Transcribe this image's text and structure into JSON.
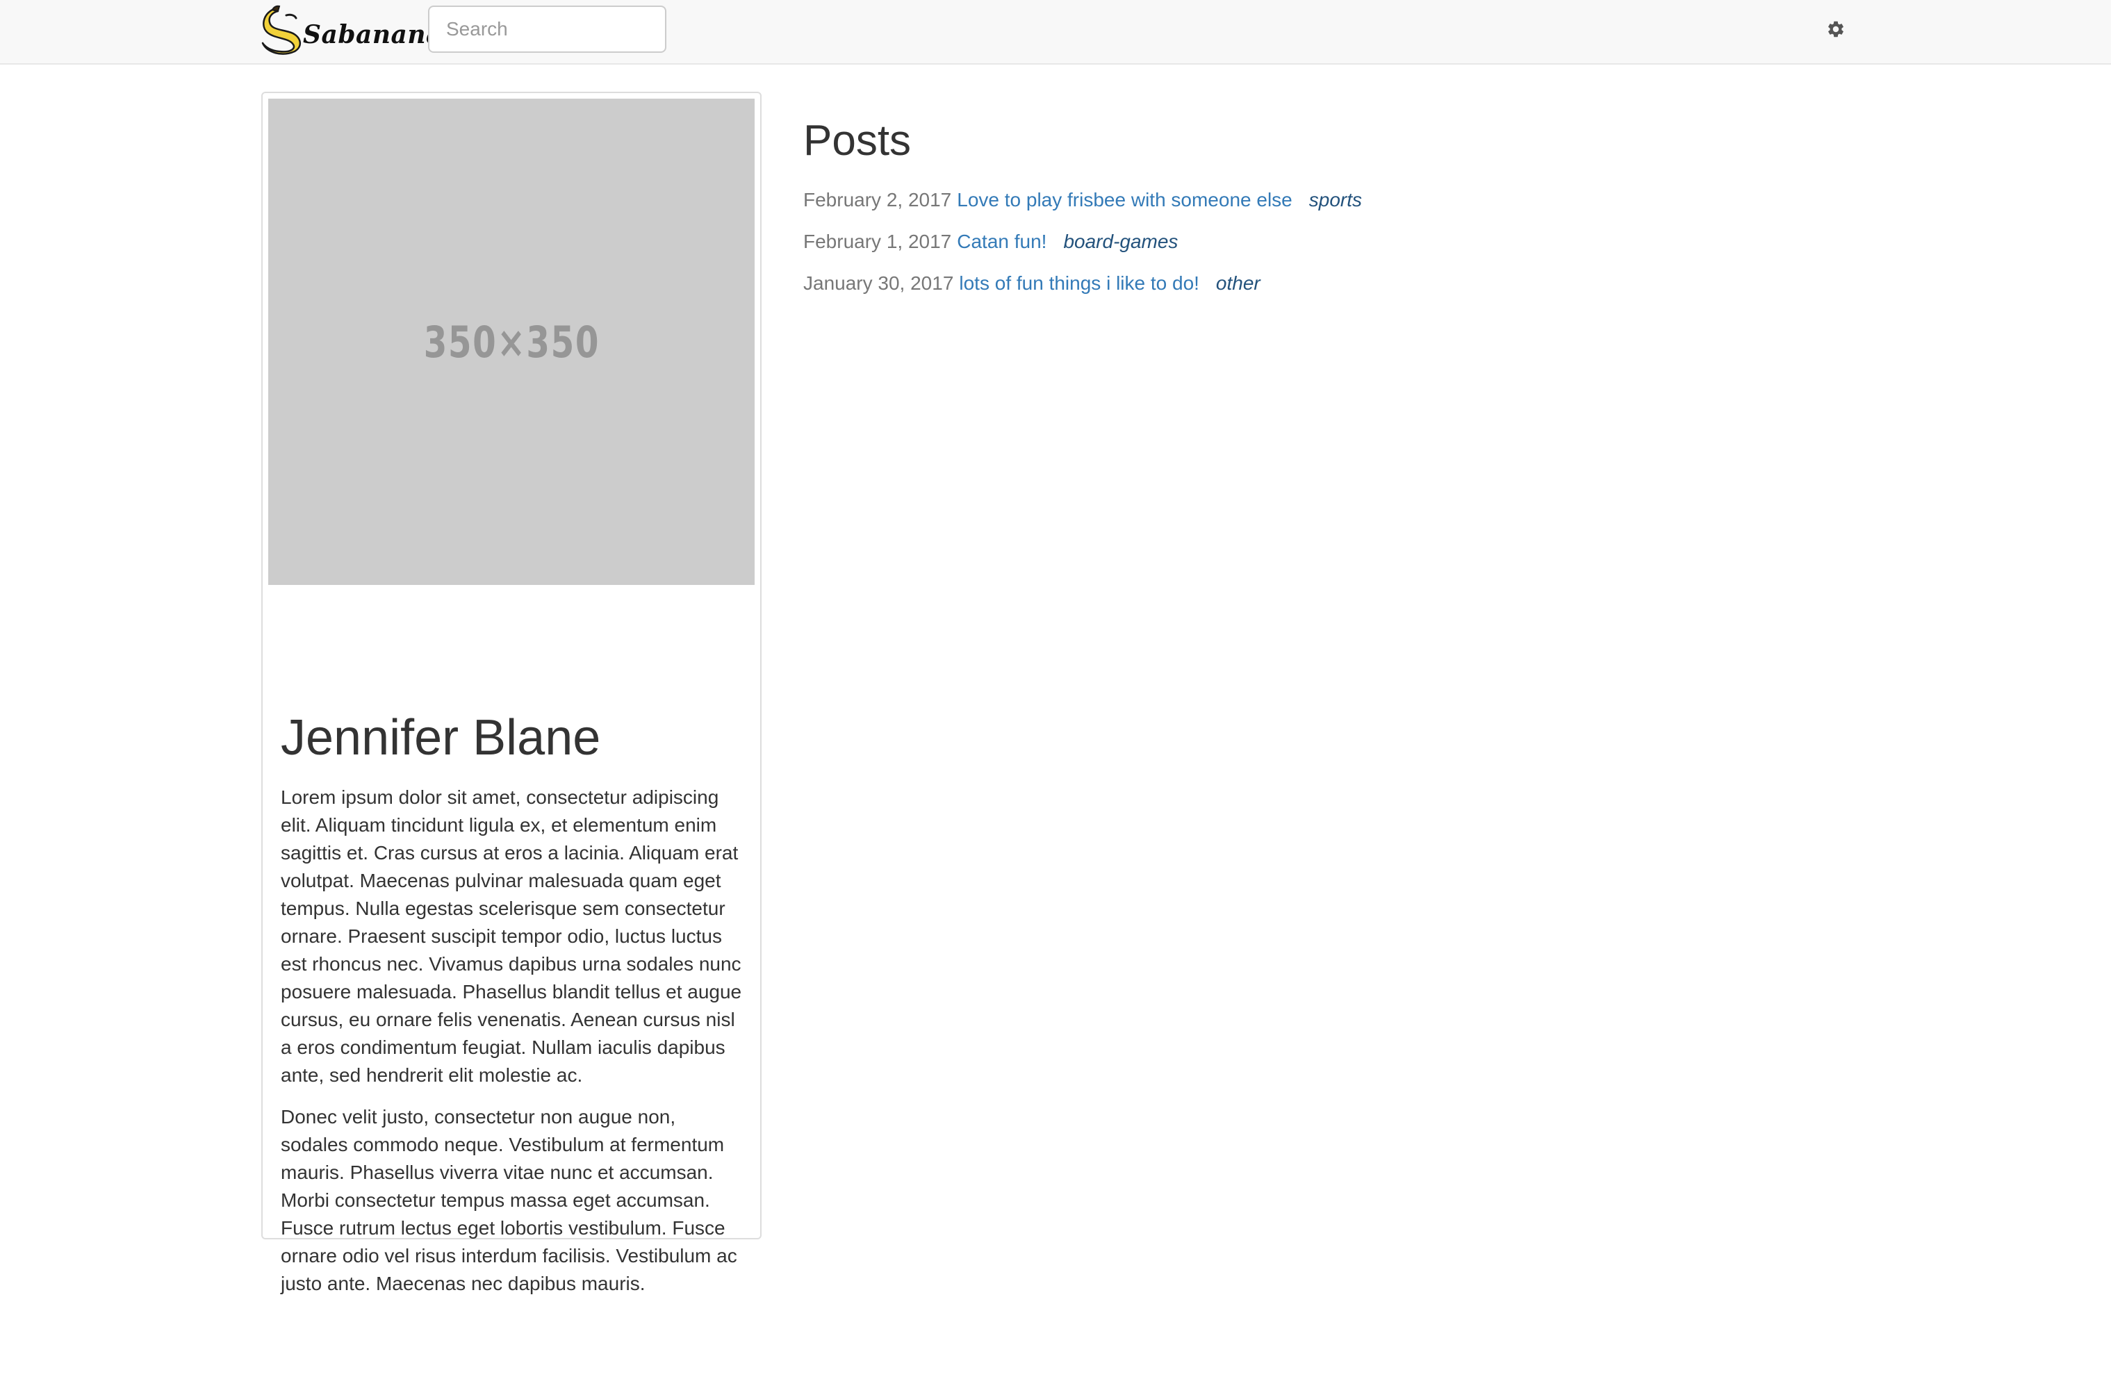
{
  "navbar": {
    "brand": "Sabanana",
    "search_placeholder": "Search",
    "settings_icon": "gear-icon"
  },
  "profile": {
    "image_label": "350×350",
    "name": "Jennifer Blane",
    "bio": [
      "Lorem ipsum dolor sit amet, consectetur adipiscing elit. Aliquam tincidunt ligula ex, et elementum enim sagittis et. Cras cursus at eros a lacinia. Aliquam erat volutpat. Maecenas pulvinar malesuada quam eget tempus. Nulla egestas scelerisque sem consectetur ornare. Praesent suscipit tempor odio, luctus luctus est rhoncus nec. Vivamus dapibus urna sodales nunc posuere malesuada. Phasellus blandit tellus et augue cursus, eu ornare felis venenatis. Aenean cursus nisl a eros condimentum feugiat. Nullam iaculis dapibus ante, sed hendrerit elit molestie ac.",
      "Donec velit justo, consectetur non augue non, sodales commodo neque. Vestibulum at fermentum mauris. Phasellus viverra vitae nunc et accumsan. Morbi consectetur tempus massa eget accumsan. Fusce rutrum lectus eget lobortis vestibulum. Fusce ornare odio vel risus interdum facilisis. Vestibulum ac justo ante. Maecenas nec dapibus mauris."
    ]
  },
  "posts": {
    "title": "Posts",
    "items": [
      {
        "date": "February 2, 2017",
        "title": "Love to play frisbee with someone else",
        "tag": "sports"
      },
      {
        "date": "February 1, 2017",
        "title": "Catan fun!",
        "tag": "board-games"
      },
      {
        "date": "January 30, 2017",
        "title": "lots of fun things i like to do!",
        "tag": "other"
      }
    ]
  },
  "colors": {
    "link": "#337ab7",
    "tag": "#23527c",
    "muted": "#777777",
    "navbar_bg": "#f8f8f8",
    "placeholder_bg": "#cccccc",
    "logo_yellow": "#f2d23a"
  }
}
